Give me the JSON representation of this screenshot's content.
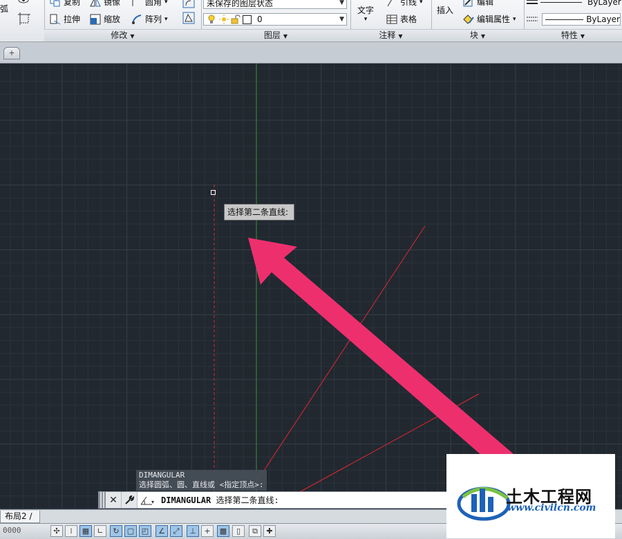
{
  "ribbon": {
    "draw_partial": "弧",
    "modify": {
      "copy": "复制",
      "mirror": "镜像",
      "fillet": "圆角",
      "stretch": "拉伸",
      "scale": "缩放",
      "array": "阵列",
      "title": "修改"
    },
    "layers": {
      "state_value": "未保存的图层状态",
      "layer_value": "0",
      "title": "图层"
    },
    "annotation": {
      "text": "文字",
      "leader": "引线",
      "table": "表格",
      "title": "注释"
    },
    "block": {
      "insert": "插入",
      "edit": "编辑",
      "edit_attributes": "编辑属性",
      "title": "块"
    },
    "properties": {
      "linetype": "ByLayer",
      "lineweight": "ByLayer",
      "title": "特性"
    }
  },
  "drawing": {
    "tooltip": "选择第二条直线:"
  },
  "command": {
    "history": [
      "DIMANGULAR",
      "选择圆弧、圆、直线或 <指定顶点>:"
    ],
    "command_name": "DIMANGULAR",
    "prompt": "选择第二条直线:"
  },
  "layout_tab": "布局2",
  "status": {
    "coords": "0000"
  },
  "watermark": {
    "title": "土木工程网",
    "url": "www.civilcn.com"
  },
  "colors": {
    "background": "#212830",
    "grid_minor": "#2a323b",
    "grid_major": "#353e48",
    "red_lines": "#e0262f",
    "green_axis": "#3a8f3a",
    "arrow": "#ee2f6e",
    "watermark_blue": "#1d62b8"
  }
}
